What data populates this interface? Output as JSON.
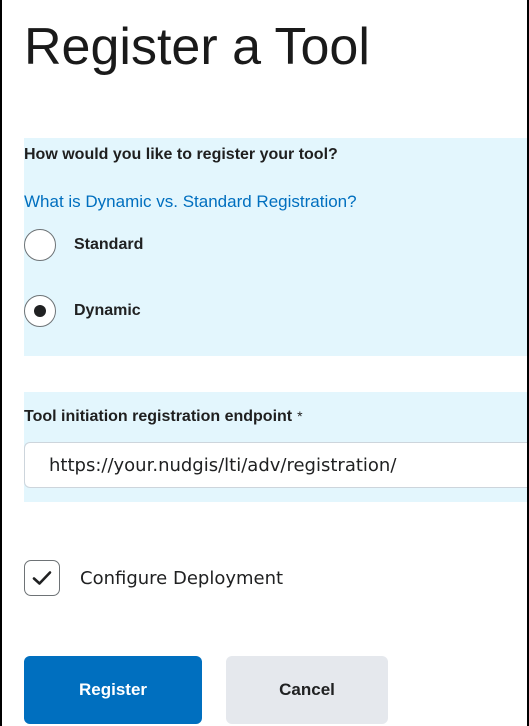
{
  "page": {
    "title": "Register a Tool"
  },
  "registration": {
    "question": "How would you like to register your tool?",
    "help_link": "What is Dynamic vs. Standard Registration?",
    "options": [
      {
        "label": "Standard",
        "selected": false
      },
      {
        "label": "Dynamic",
        "selected": true
      }
    ]
  },
  "endpoint": {
    "label": "Tool initiation registration endpoint",
    "required_marker": "*",
    "value": "https://your.nudgis/lti/adv/registration/"
  },
  "deployment": {
    "label": "Configure Deployment",
    "checked": true
  },
  "actions": {
    "register_label": "Register",
    "cancel_label": "Cancel"
  },
  "colors": {
    "accent": "#006fbf",
    "panel_background": "#e3f6fd",
    "secondary_button": "#e5e8ed"
  },
  "icons": {
    "checkbox_mark": "checkmark-icon",
    "radio_mark": "radio-dot-icon"
  }
}
